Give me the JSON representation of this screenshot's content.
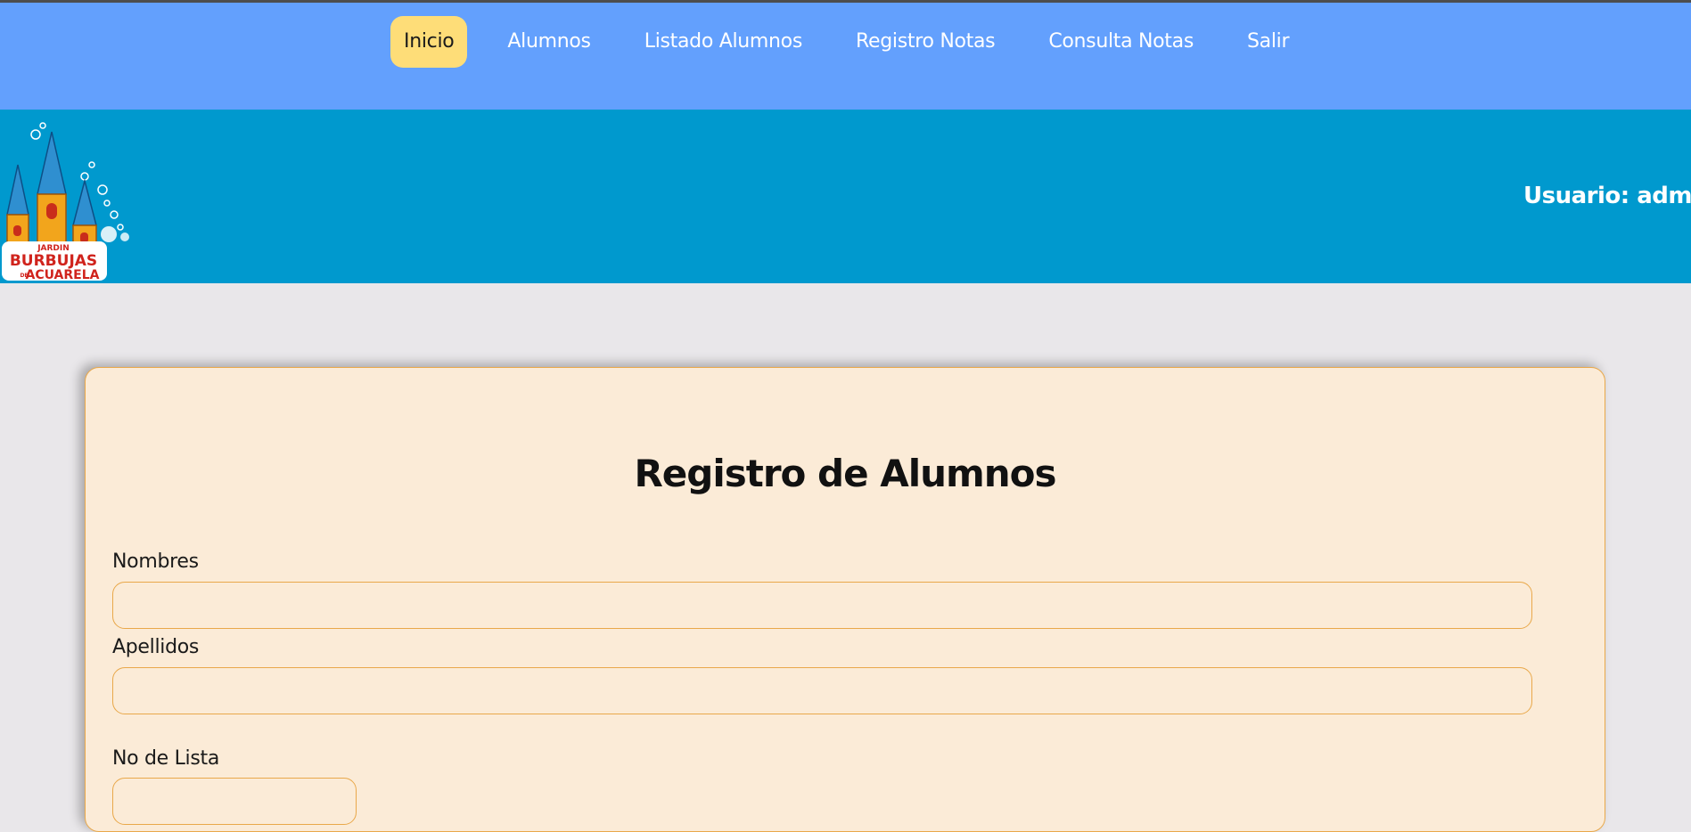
{
  "nav": {
    "items": [
      {
        "label": "Inicio",
        "active": true
      },
      {
        "label": "Alumnos",
        "active": false
      },
      {
        "label": "Listado Alumnos",
        "active": false
      },
      {
        "label": "Registro Notas",
        "active": false
      },
      {
        "label": "Consulta Notas",
        "active": false
      },
      {
        "label": "Salir",
        "active": false
      }
    ]
  },
  "header": {
    "logo_text": {
      "line1": "JARDIN",
      "line2": "BURBUJAS",
      "line3_prefix": "DE",
      "line3": "ACUARELA"
    },
    "user_label": "Usuario: admin"
  },
  "form": {
    "title": "Registro de Alumnos",
    "fields": [
      {
        "label": "Nombres",
        "value": "",
        "placeholder": ""
      },
      {
        "label": "Apellidos",
        "value": "",
        "placeholder": ""
      },
      {
        "label": "No de Lista",
        "value": "",
        "placeholder": ""
      }
    ]
  },
  "colors": {
    "nav_bg": "#63a0fd",
    "nav_active": "#fedd78",
    "banner_bg": "#0099ce",
    "card_bg": "#fbebd7",
    "card_border": "#e9a84a",
    "page_bg": "#e9e7ea"
  }
}
